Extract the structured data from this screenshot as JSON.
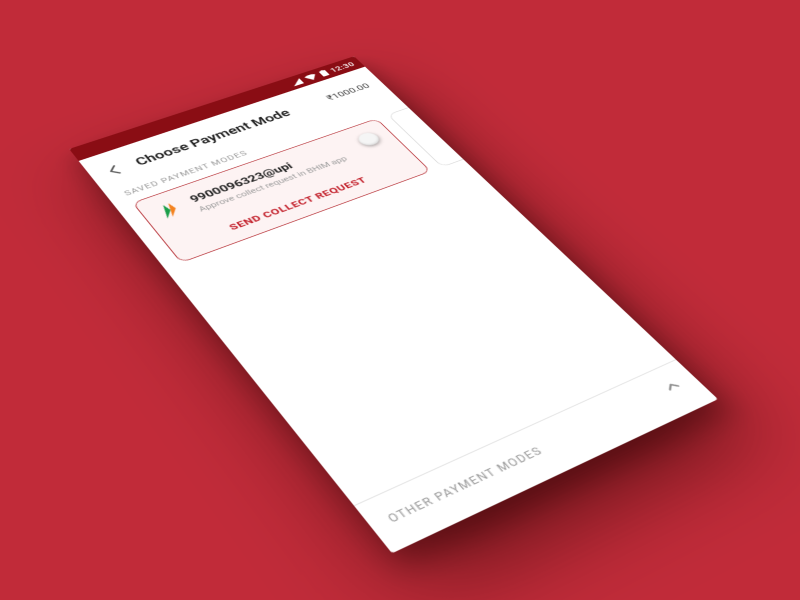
{
  "statusbar": {
    "time": "12:30"
  },
  "header": {
    "title": "Choose Payment Mode",
    "amount": "₹1000.00"
  },
  "sections": {
    "saved_label": "SAVED PAYMENT MODES",
    "other_label": "OTHER PAYMENT MODES"
  },
  "saved_card": {
    "upi_id": "9900096323@upi",
    "hint": "Approve collect request in BHIM app",
    "cta": "SEND COLLECT REQUEST"
  }
}
